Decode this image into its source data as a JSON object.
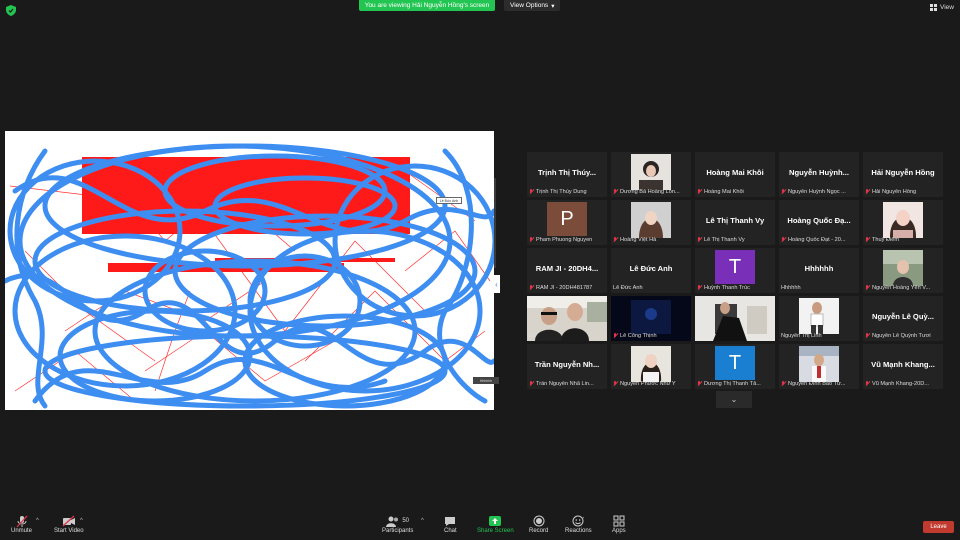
{
  "top_bar": {
    "banner": "You are viewing Hải Nguyễn Hồng's screen",
    "view_options": "View Options",
    "view": "View"
  },
  "shared_screen": {
    "chip_1": "Lê Đức Anh",
    "chip_2": "Hhhhhh"
  },
  "gallery": {
    "tiles": [
      {
        "big": "Trịnh Thị Thúy...",
        "label": "Trịnh Thị Thúy Dung"
      },
      {
        "big": "",
        "label": "Dương Bá Hoàng Lon..."
      },
      {
        "big": "Hoàng Mai Khôi",
        "label": "Hoàng Mai Khôi"
      },
      {
        "big": "Nguyễn Huỳnh...",
        "label": "Nguyễn Huỳnh Ngọc ..."
      },
      {
        "big": "Hải Nguyễn Hồng",
        "label": "Hải Nguyễn Hồng"
      },
      {
        "big": "",
        "avatar": "P",
        "label": "Pham Phuong Nguyen"
      },
      {
        "big": "",
        "label": "Hoàng Việt Hà"
      },
      {
        "big": "Lê Thị Thanh Vy",
        "label": "Lê Thị Thanh Vy"
      },
      {
        "big": "Hoàng Quốc Đạ...",
        "label": "Hoàng Quốc Đạt - 20..."
      },
      {
        "big": "",
        "label": "Thuỳ Điểm"
      },
      {
        "big": "RAM JI - 20DH4...",
        "label": "RAM JI - 20DH481787"
      },
      {
        "big": "Lê Đức Anh",
        "label": "Lê Đức Anh"
      },
      {
        "big": "",
        "avatar": "T",
        "label": "Huỳnh Thanh Trúc"
      },
      {
        "big": "Hhhhhh",
        "label": "Hhhhhh"
      },
      {
        "big": "",
        "label": "Nguyễn Hoàng Yến V..."
      },
      {
        "big": "",
        "label": "Đô"
      },
      {
        "big": "",
        "label": "Lê Công Thịnh"
      },
      {
        "big": "",
        "label": ""
      },
      {
        "big": "",
        "label": "Nguyễn Thị Linh"
      },
      {
        "big": "Nguyễn Lê Quỳ...",
        "label": "Nguyễn Lê Quỳnh Tươi"
      },
      {
        "big": "Trần Nguyễn Nh...",
        "label": "Trần Nguyễn Nhã Lin..."
      },
      {
        "big": "",
        "label": "Nguyễn Phước Như Ý"
      },
      {
        "big": "",
        "avatar": "T",
        "label": "Dương Thị Thanh Tâ..."
      },
      {
        "big": "",
        "label": "Nguyễn Đình Bảo Tư..."
      },
      {
        "big": "Vũ Mạnh Khang...",
        "label": "Vũ Mạnh Khang-20D..."
      }
    ]
  },
  "toolbar": {
    "unmute": "Unmute",
    "start_video": "Start Video",
    "participants": "Participants",
    "participants_count": "50",
    "chat": "Chat",
    "share_screen": "Share Screen",
    "record": "Record",
    "reactions": "Reactions",
    "apps": "Apps",
    "leave": "Leave"
  },
  "colors": {
    "banner_green": "#23c552",
    "scribble_blue": "#3d8ef0",
    "scribble_red": "#ff1a1a",
    "avatar_brown": "#7b4c3a",
    "avatar_purple": "#7a2fb8",
    "avatar_blue": "#1a7fd1",
    "active_outline": "#c8e63c",
    "leave_red": "#c03a30"
  }
}
